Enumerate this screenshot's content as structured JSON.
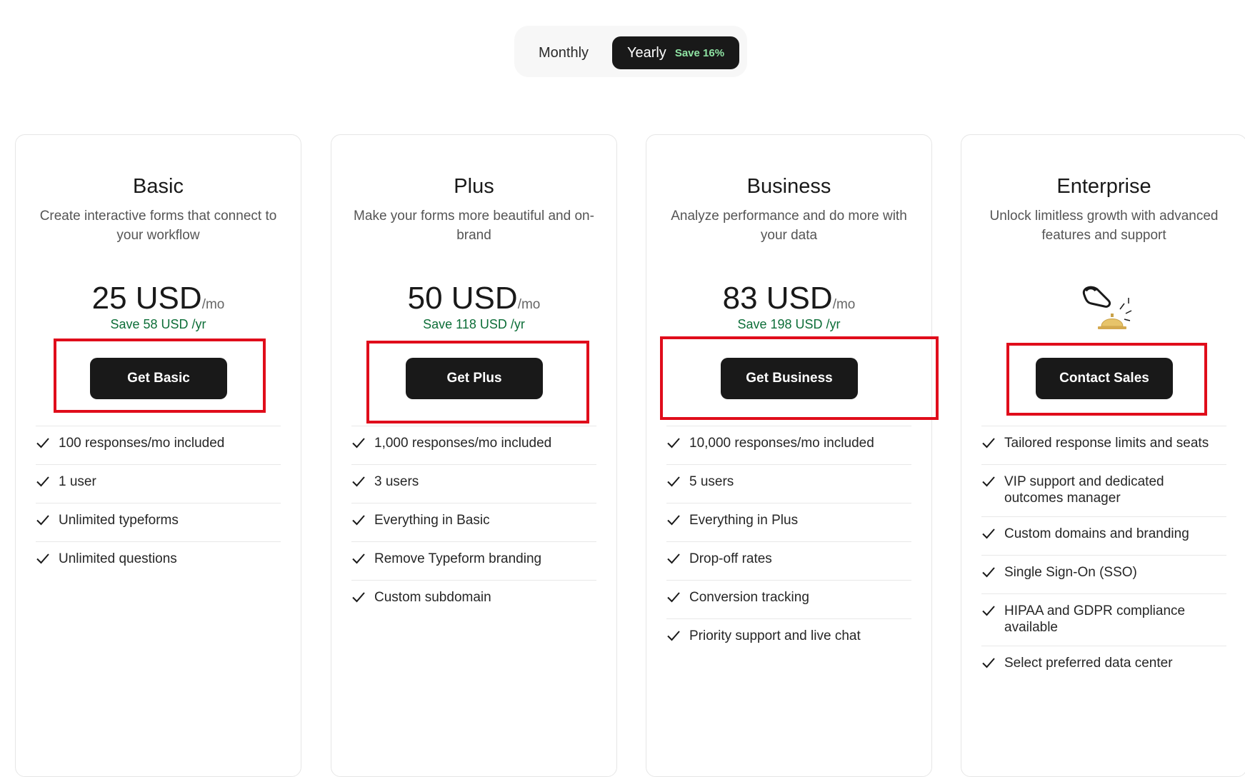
{
  "billing_toggle": {
    "monthly_label": "Monthly",
    "yearly_label": "Yearly",
    "yearly_save": "Save 16%",
    "selected": "Yearly"
  },
  "plans": [
    {
      "name": "Basic",
      "description": "Create interactive forms that connect to your workflow",
      "price": "25 USD",
      "price_unit": "/mo",
      "save": "Save 58 USD /yr",
      "cta": "Get Basic",
      "features": [
        "100 responses/mo included",
        "1 user",
        "Unlimited typeforms",
        "Unlimited questions"
      ]
    },
    {
      "name": "Plus",
      "description": "Make your forms more beautiful and on-brand",
      "price": "50 USD",
      "price_unit": "/mo",
      "save": "Save 118 USD /yr",
      "cta": "Get Plus",
      "features": [
        "1,000 responses/mo included",
        "3 users",
        "Everything in Basic",
        "Remove Typeform branding",
        "Custom subdomain"
      ]
    },
    {
      "name": "Business",
      "description": "Analyze performance and do more with your data",
      "price": "83 USD",
      "price_unit": "/mo",
      "save": "Save 198 USD /yr",
      "cta": "Get Business",
      "features": [
        "10,000 responses/mo included",
        "5 users",
        "Everything in Plus",
        "Drop-off rates",
        "Conversion tracking",
        "Priority support and live chat"
      ]
    },
    {
      "name": "Enterprise",
      "description": "Unlock limitless growth with advanced features and support",
      "icon": "service-bell-icon",
      "cta": "Contact Sales",
      "features": [
        "Tailored response limits and seats",
        "VIP support and dedicated outcomes manager",
        "Custom domains and branding",
        "Single Sign-On (SSO)",
        "HIPAA and GDPR compliance available",
        "Select preferred data center"
      ]
    }
  ],
  "colors": {
    "button": "#191919",
    "save_text": "#0d6e38",
    "highlight": "#e00d1b",
    "toggle_save": "#8fe3a3"
  }
}
